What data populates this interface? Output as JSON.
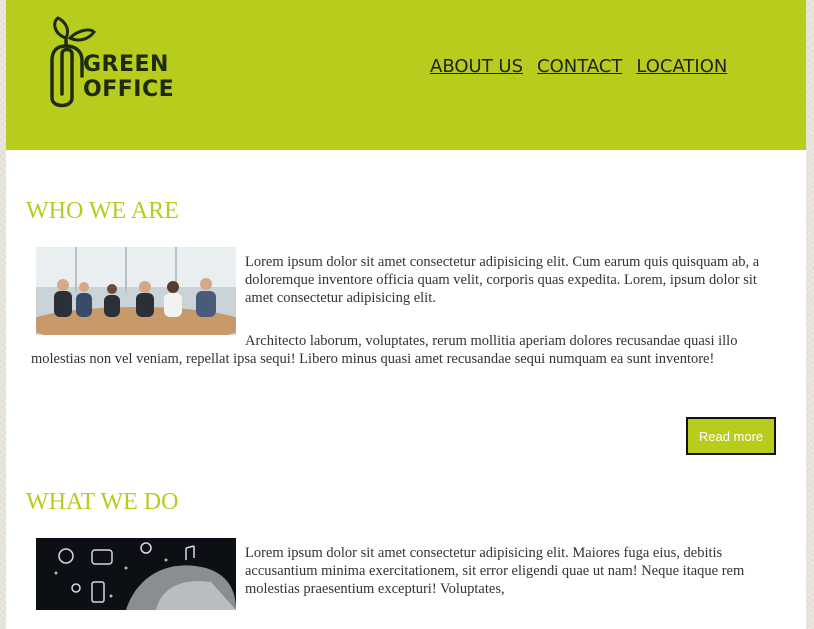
{
  "header": {
    "logo": {
      "line1": "GREEN",
      "line2": "OFFICE"
    },
    "nav": [
      "ABOUT US",
      "CONTACT",
      "LOCATION"
    ]
  },
  "who_we_are": {
    "title": "WHO WE ARE",
    "paragraph1": "Lorem ipsum dolor sit amet consectetur adipisicing elit. Cum earum quis quisquam ab, a doloremque inventore officia quam velit, corporis quas expedita. Lorem, ipsum dolor sit amet consectetur adipisicing elit.",
    "paragraph2": "Architecto laborum, voluptates, rerum mollitia aperiam dolores recusandae quasi illo molestias non vel veniam, repellat ipsa sequi! Libero minus quasi amet recusandae sequi numquam ea sunt inventore!",
    "button": "Read more"
  },
  "what_we_do": {
    "title": "WHAT WE DO",
    "paragraph1": "Lorem ipsum dolor sit amet consectetur adipisicing elit. Maiores fuga eius, debitis accusantium minima exercitationem, sit error eligendi quae ut nam! Neque itaque rem molestias praesentium excepturi! Voluptates,"
  },
  "colors": {
    "brand": "#b8cc1e",
    "nav_text": "#1c2410",
    "body_text": "#333333"
  }
}
